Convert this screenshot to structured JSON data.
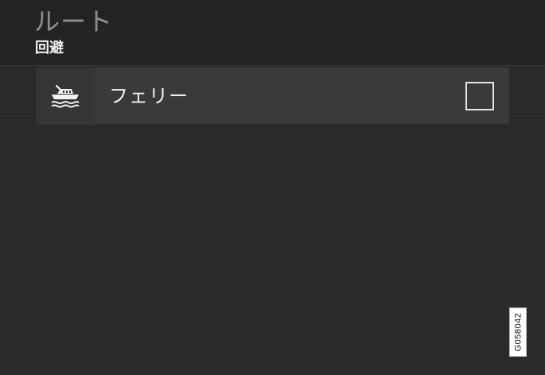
{
  "header": {
    "title": "ルート",
    "subtitle": "回避"
  },
  "list": {
    "items": [
      {
        "icon": "ferry-icon",
        "label": "フェリー",
        "checked": false
      }
    ]
  },
  "figure_code": "G058042",
  "colors": {
    "background": "#29292a",
    "item_background": "#3a393c",
    "title_gray": "#8e8e90",
    "text_white": "#f0f0f0"
  }
}
